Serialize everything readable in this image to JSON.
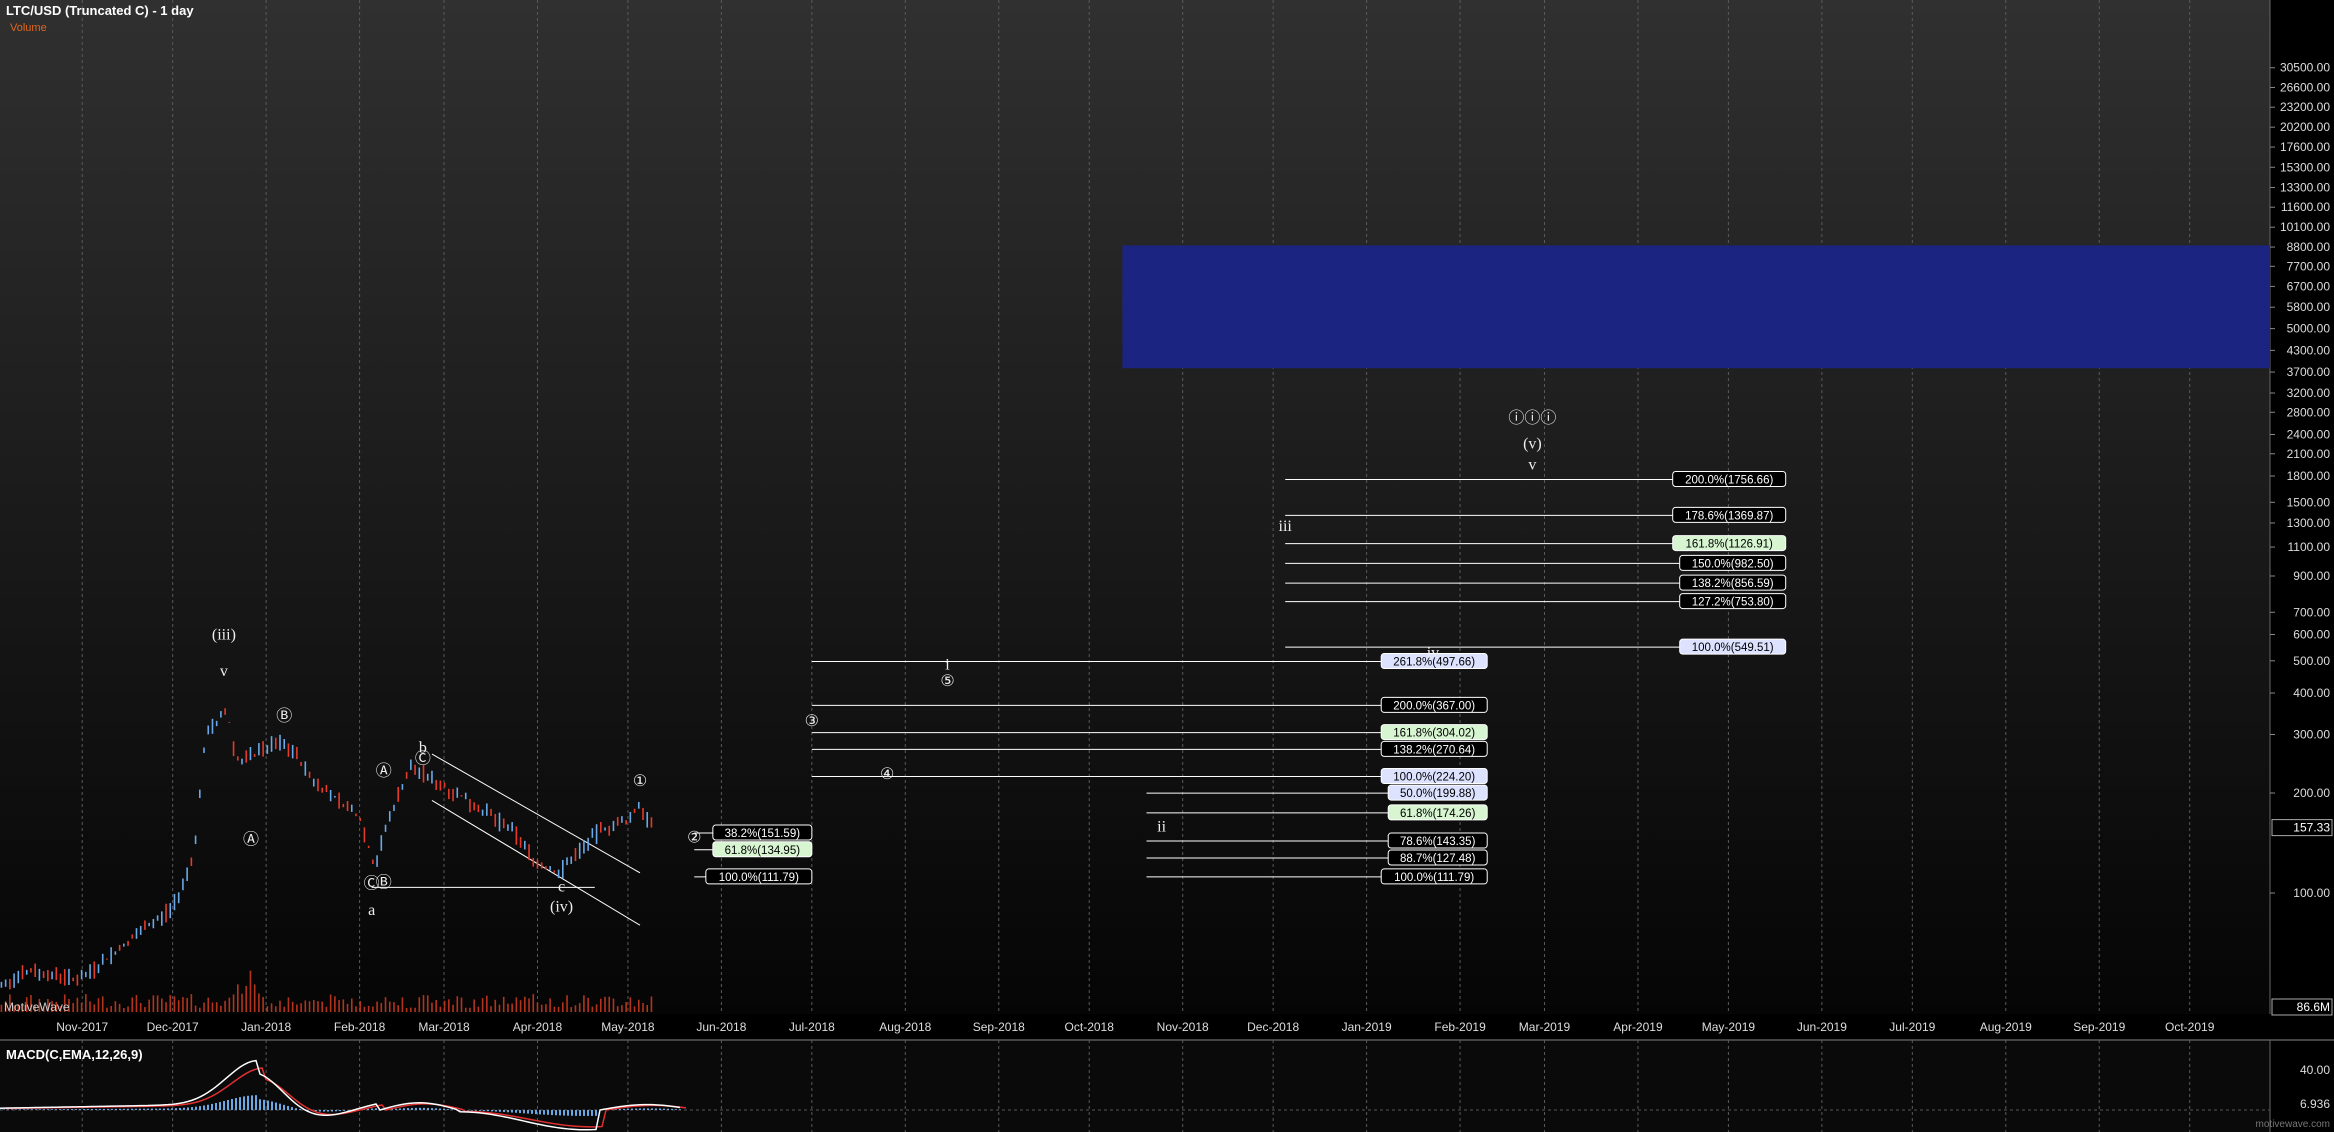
{
  "header": {
    "title": "LTC/USD (Truncated C) - 1 day",
    "volume_label": "Volume",
    "brand": "MotiveWave",
    "watermark": "motivewave.com"
  },
  "macd": {
    "label": "MACD(C,EMA,12,26,9)",
    "ticks": [
      "40.00",
      "6.936"
    ]
  },
  "colors": {
    "background": "#000000",
    "grid": "#5a5a5a",
    "target_box": "#1c2481",
    "price_up": "#6aa8e8",
    "price_down": "#e43a2a",
    "volume": "#b3341d",
    "macd_line": "#ffffff",
    "signal_line": "#e03030",
    "histogram": "#6aa8e8"
  },
  "chart_data": {
    "type": "line",
    "title": "LTC/USD (Truncated C) - 1 day",
    "y_scale": "log",
    "x_tick_labels": [
      "Nov-2017",
      "Dec-2017",
      "Jan-2018",
      "Feb-2018",
      "Mar-2018",
      "Apr-2018",
      "May-2018",
      "Jun-2018",
      "Jul-2018",
      "Aug-2018",
      "Sep-2018",
      "Oct-2018",
      "Nov-2018",
      "Dec-2018",
      "Jan-2019",
      "Feb-2019",
      "Mar-2019",
      "Apr-2019",
      "May-2019",
      "Jun-2019",
      "Jul-2019",
      "Aug-2019",
      "Sep-2019",
      "Oct-2019"
    ],
    "y_tick_labels": [
      "30500.00",
      "26600.00",
      "23200.00",
      "20200.00",
      "17600.00",
      "15300.00",
      "13300.00",
      "11600.00",
      "10100.00",
      "8800.00",
      "7700.00",
      "6700.00",
      "5800.00",
      "5000.00",
      "4300.00",
      "3700.00",
      "3200.00",
      "2800.00",
      "2400.00",
      "2100.00",
      "1800.00",
      "1500.00",
      "1300.00",
      "1100.00",
      "900.00",
      "700.00",
      "600.00",
      "500.00",
      "400.00",
      "300.00",
      "200.00",
      "100.00"
    ],
    "current_price": "157.33",
    "volume_readout": "86.6M",
    "price_series": {
      "name": "LTC/USD",
      "points": [
        [
          "2017-10-01",
          52
        ],
        [
          "2017-10-15",
          58
        ],
        [
          "2017-11-01",
          55
        ],
        [
          "2017-11-15",
          70
        ],
        [
          "2017-12-01",
          90
        ],
        [
          "2017-12-08",
          130
        ],
        [
          "2017-12-12",
          300
        ],
        [
          "2017-12-15",
          320
        ],
        [
          "2017-12-19",
          360
        ],
        [
          "2017-12-22",
          250
        ],
        [
          "2017-12-28",
          260
        ],
        [
          "2018-01-05",
          285
        ],
        [
          "2018-01-10",
          270
        ],
        [
          "2018-01-16",
          220
        ],
        [
          "2018-01-25",
          190
        ],
        [
          "2018-02-01",
          170
        ],
        [
          "2018-02-06",
          120
        ],
        [
          "2018-02-10",
          160
        ],
        [
          "2018-02-14",
          200
        ],
        [
          "2018-02-18",
          240
        ],
        [
          "2018-02-25",
          220
        ],
        [
          "2018-03-05",
          200
        ],
        [
          "2018-03-15",
          175
        ],
        [
          "2018-03-25",
          150
        ],
        [
          "2018-04-01",
          122
        ],
        [
          "2018-04-08",
          115
        ],
        [
          "2018-04-15",
          135
        ],
        [
          "2018-04-22",
          155
        ],
        [
          "2018-05-01",
          165
        ],
        [
          "2018-05-05",
          185
        ],
        [
          "2018-05-09",
          157
        ]
      ]
    },
    "wave_labels": [
      [
        "(iii)",
        "2017-12-18",
        580
      ],
      [
        "v",
        "2017-12-18",
        450
      ],
      [
        "Ⓐ",
        "2017-12-27",
        140
      ],
      [
        "Ⓑ",
        "2018-01-07",
        330
      ],
      [
        "Ⓐ",
        "2018-02-09",
        225
      ],
      [
        "Ⓒ",
        "2018-02-05",
        103
      ],
      [
        "Ⓑ",
        "2018-02-09",
        104
      ],
      [
        "a",
        "2018-02-05",
        86
      ],
      [
        "b",
        "2018-02-22",
        265
      ],
      [
        "Ⓒ",
        "2018-02-22",
        245
      ],
      [
        "c",
        "2018-04-09",
        101
      ],
      [
        "(iv)",
        "2018-04-09",
        88
      ],
      [
        "①",
        "2018-05-05",
        210
      ],
      [
        "②",
        "2018-05-23",
        142
      ],
      [
        "③",
        "2018-07-01",
        318
      ],
      [
        "④",
        "2018-07-26",
        220
      ],
      [
        "⑤",
        "2018-08-15",
        420
      ],
      [
        "i",
        "2018-08-15",
        470
      ],
      [
        "ii",
        "2018-10-25",
        153
      ],
      [
        "iii",
        "2018-12-05",
        1230
      ],
      [
        "iv",
        "2019-01-23",
        512
      ],
      [
        "ⓘⓘⓘ",
        "2019-02-25",
        2600
      ],
      [
        "(v)",
        "2019-02-25",
        2180
      ],
      [
        "v",
        "2019-02-25",
        1880
      ]
    ],
    "target_zone": {
      "start": "2018-10-12",
      "end": "2019-10-31",
      "low": 3800,
      "high": 8900
    },
    "fib_levels": [
      {
        "label": "38.2%(151.59)",
        "price": 151.59,
        "start": "2018-05-23",
        "end": "2018-07-01",
        "highlight": false
      },
      {
        "label": "61.8%(134.95)",
        "price": 134.95,
        "start": "2018-05-23",
        "end": "2018-07-01",
        "highlight": true
      },
      {
        "label": "100.0%(111.79)",
        "price": 111.79,
        "start": "2018-05-23",
        "end": "2018-07-01",
        "highlight": false
      },
      {
        "label": "261.8%(497.66)",
        "price": 497.66,
        "start": "2018-07-01",
        "end": "2019-02-10",
        "highlight": "blue"
      },
      {
        "label": "200.0%(367.00)",
        "price": 367.0,
        "start": "2018-07-01",
        "end": "2019-02-10",
        "highlight": false
      },
      {
        "label": "161.8%(304.02)",
        "price": 304.02,
        "start": "2018-07-01",
        "end": "2019-02-10",
        "highlight": true
      },
      {
        "label": "138.2%(270.64)",
        "price": 270.64,
        "start": "2018-07-01",
        "end": "2019-02-10",
        "highlight": false
      },
      {
        "label": "100.0%(224.20)",
        "price": 224.2,
        "start": "2018-07-01",
        "end": "2019-02-10",
        "highlight": "blue"
      },
      {
        "label": "50.0%(199.88)",
        "price": 199.88,
        "start": "2018-10-20",
        "end": "2019-02-10",
        "highlight": "blue"
      },
      {
        "label": "61.8%(174.26)",
        "price": 174.26,
        "start": "2018-10-20",
        "end": "2019-02-10",
        "highlight": true
      },
      {
        "label": "78.6%(143.35)",
        "price": 143.35,
        "start": "2018-10-20",
        "end": "2019-02-10",
        "highlight": false
      },
      {
        "label": "88.7%(127.48)",
        "price": 127.48,
        "start": "2018-10-20",
        "end": "2019-02-10",
        "highlight": false
      },
      {
        "label": "100.0%(111.79)",
        "price": 111.79,
        "start": "2018-10-20",
        "end": "2019-02-10",
        "highlight": false
      },
      {
        "label": "200.0%(1756.66)",
        "price": 1756.66,
        "start": "2018-12-05",
        "end": "2019-05-20",
        "highlight": false
      },
      {
        "label": "178.6%(1369.87)",
        "price": 1369.87,
        "start": "2018-12-05",
        "end": "2019-05-20",
        "highlight": false
      },
      {
        "label": "161.8%(1126.91)",
        "price": 1126.91,
        "start": "2018-12-05",
        "end": "2019-05-20",
        "highlight": true
      },
      {
        "label": "150.0%(982.50)",
        "price": 982.5,
        "start": "2018-12-05",
        "end": "2019-05-20",
        "highlight": false
      },
      {
        "label": "138.2%(856.59)",
        "price": 856.59,
        "start": "2018-12-05",
        "end": "2019-05-20",
        "highlight": false
      },
      {
        "label": "127.2%(753.80)",
        "price": 753.8,
        "start": "2018-12-05",
        "end": "2019-05-20",
        "highlight": false
      },
      {
        "label": "100.0%(549.51)",
        "price": 549.51,
        "start": "2018-12-05",
        "end": "2019-05-20",
        "highlight": "blue"
      }
    ],
    "channel": {
      "upper": [
        [
          "2018-02-25",
          262
        ],
        [
          "2018-05-05",
          115
        ]
      ],
      "lower": [
        [
          "2018-02-25",
          190
        ],
        [
          "2018-05-05",
          80
        ]
      ]
    },
    "support_line": {
      "price": 104,
      "start": "2018-02-05",
      "end": "2018-04-20"
    }
  }
}
